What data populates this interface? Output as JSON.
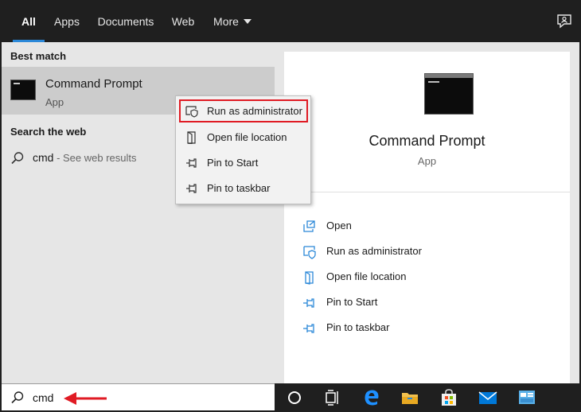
{
  "tabs": [
    {
      "label": "All",
      "active": true
    },
    {
      "label": "Apps"
    },
    {
      "label": "Documents"
    },
    {
      "label": "Web"
    },
    {
      "label": "More"
    }
  ],
  "icons": {
    "feedback": "feedback-icon",
    "search": "search-icon",
    "run_as_admin": "shield-icon",
    "open_location": "folder-icon",
    "pin": "pin-icon"
  },
  "left": {
    "best_match_header": "Best match",
    "best_match": {
      "title": "Command Prompt",
      "subtitle": "App"
    },
    "search_web_header": "Search the web",
    "web_result": {
      "query": "cmd",
      "hint": " - See web results"
    }
  },
  "context_menu": {
    "items": [
      {
        "label": "Run as administrator",
        "highlighted": true
      },
      {
        "label": "Open file location"
      },
      {
        "label": "Pin to Start"
      },
      {
        "label": "Pin to taskbar"
      }
    ]
  },
  "right": {
    "title": "Command Prompt",
    "subtitle": "App",
    "actions": [
      {
        "label": "Open",
        "icon": "open-icon"
      },
      {
        "label": "Run as administrator",
        "icon": "shield-icon"
      },
      {
        "label": "Open file location",
        "icon": "folder-icon"
      },
      {
        "label": "Pin to Start",
        "icon": "pin-icon"
      },
      {
        "label": "Pin to taskbar",
        "icon": "pin-icon"
      }
    ]
  },
  "search": {
    "value": "cmd"
  },
  "taskbar": {
    "items": [
      "cortana-icon",
      "task-view-icon",
      "edge-icon",
      "file-explorer-icon",
      "store-icon",
      "mail-icon",
      "control-panel-icon"
    ]
  },
  "colors": {
    "accent": "#2b88d8",
    "highlight_border": "#e01b24",
    "dark_bar": "#1f1f1f",
    "pane_bg": "#e6e6e6",
    "selected_bg": "#cccccc"
  }
}
